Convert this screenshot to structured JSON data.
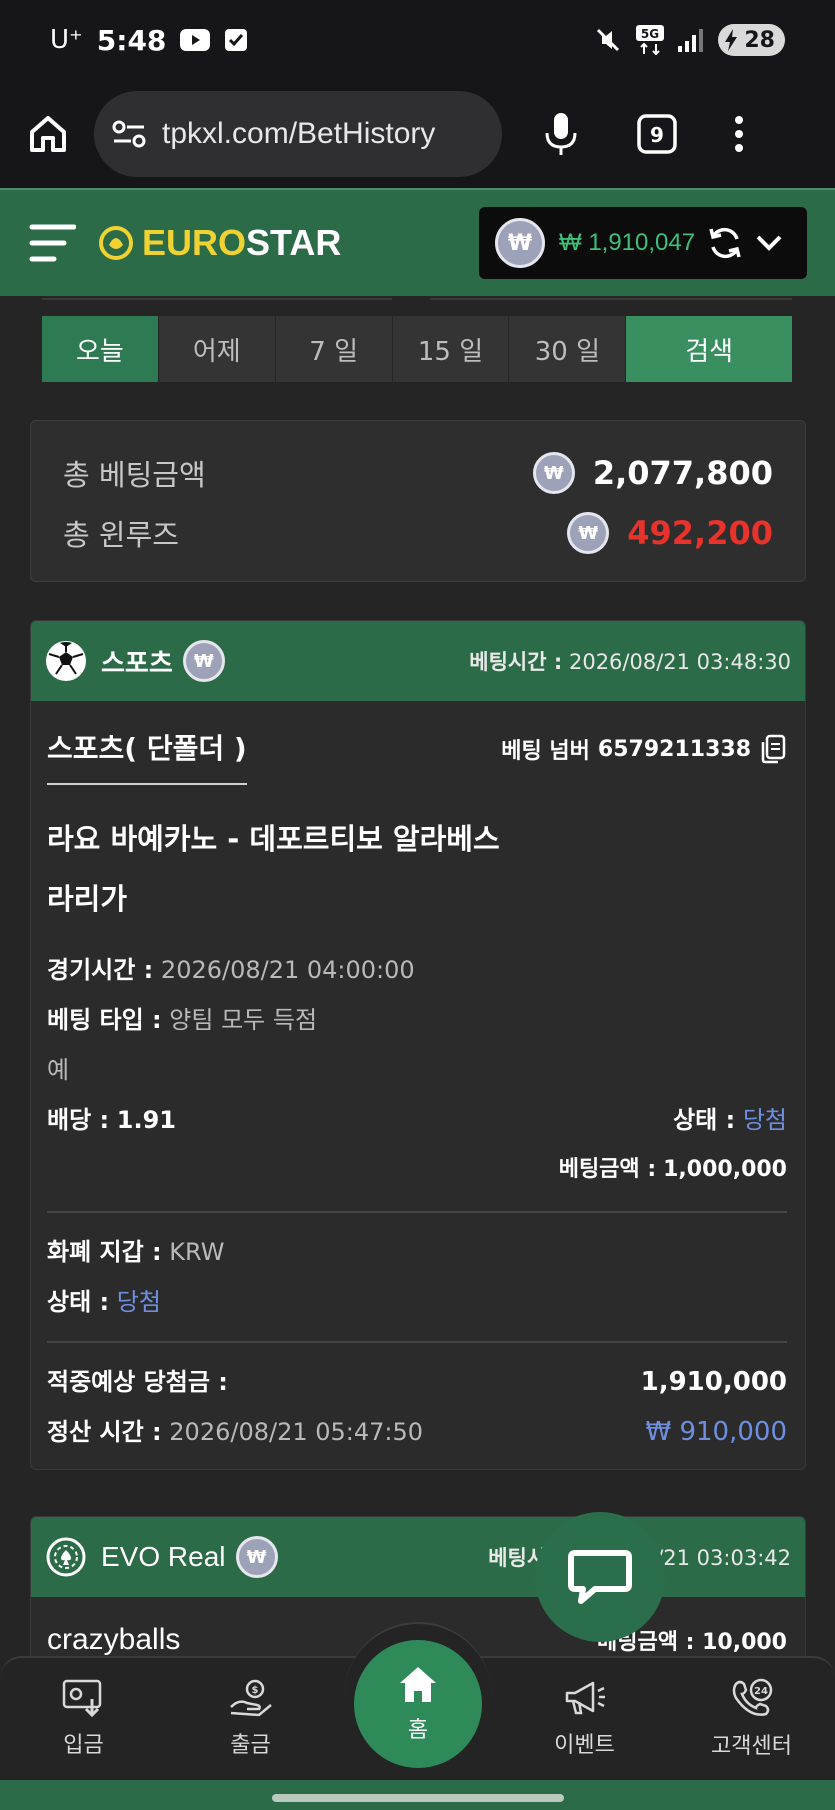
{
  "status_bar": {
    "carrier": "U⁺",
    "time": "5:48",
    "network": "5G",
    "battery": "28"
  },
  "browser": {
    "url": "tpkxl.com/BetHistory",
    "tab_count": "9"
  },
  "header": {
    "logo_part1": "EURO",
    "logo_part2": "STAR",
    "balance": "₩ 1,910,047",
    "coin_symbol": "₩"
  },
  "filters": {
    "tabs": [
      {
        "label": "오늘",
        "active": true
      },
      {
        "label": "어제"
      },
      {
        "label": "7 일"
      },
      {
        "label": "15 일"
      },
      {
        "label": "30 일"
      }
    ],
    "search_label": "검색"
  },
  "summary": {
    "total_bet_label": "총 베팅금액",
    "total_bet_value": "2,077,800",
    "total_winloss_label": "총 윈루즈",
    "total_winloss_value": "492,200"
  },
  "card1": {
    "category": "스포츠",
    "bet_time_label": "베팅시간 :",
    "bet_time": "2026/08/21 03:48:30",
    "sub_title": "스포츠( 단폴더 )",
    "bet_number_label": "베팅 넘버",
    "bet_number": "6579211338",
    "match": "라요 바예카노 - 데포르티보 알라베스",
    "league": "라리가",
    "game_time_label": "경기시간 :",
    "game_time": "2026/08/21 04:00:00",
    "bet_type_label": "베팅 타입 :",
    "bet_type": "양팀 모두 득점",
    "pick": "예",
    "odds_label": "배당 :",
    "odds": "1.91",
    "status_label": "상태 :",
    "status": "당첨",
    "bet_amount_label": "베팅금액 :",
    "bet_amount": "1,000,000",
    "wallet_label": "화폐 지갑 :",
    "wallet": "KRW",
    "status2_label": "상태 :",
    "status2": "당첨",
    "expected_win_label": "적중예상 당첨금 :",
    "expected_win": "1,910,000",
    "settle_time_label": "정산 시간 :",
    "settle_time": "2026/08/21 05:47:50",
    "profit": "₩ 910,000"
  },
  "card2": {
    "category": "EVO Real",
    "bet_time_label": "베팅시",
    "bet_time": "/21 03:03:42",
    "game": "crazyballs",
    "bet_amount_label": "베팅금액 :",
    "bet_amount": "10,000"
  },
  "bottom_nav": {
    "deposit": "입금",
    "withdraw": "출금",
    "home": "홈",
    "event": "이벤트",
    "support": "고객센터"
  },
  "colors": {
    "brand_green": "#2c6b48",
    "accent_green": "#3fbf78",
    "loss_red": "#e8322c",
    "status_blue": "#6e8fe0",
    "logo_yellow": "#f1d233"
  }
}
